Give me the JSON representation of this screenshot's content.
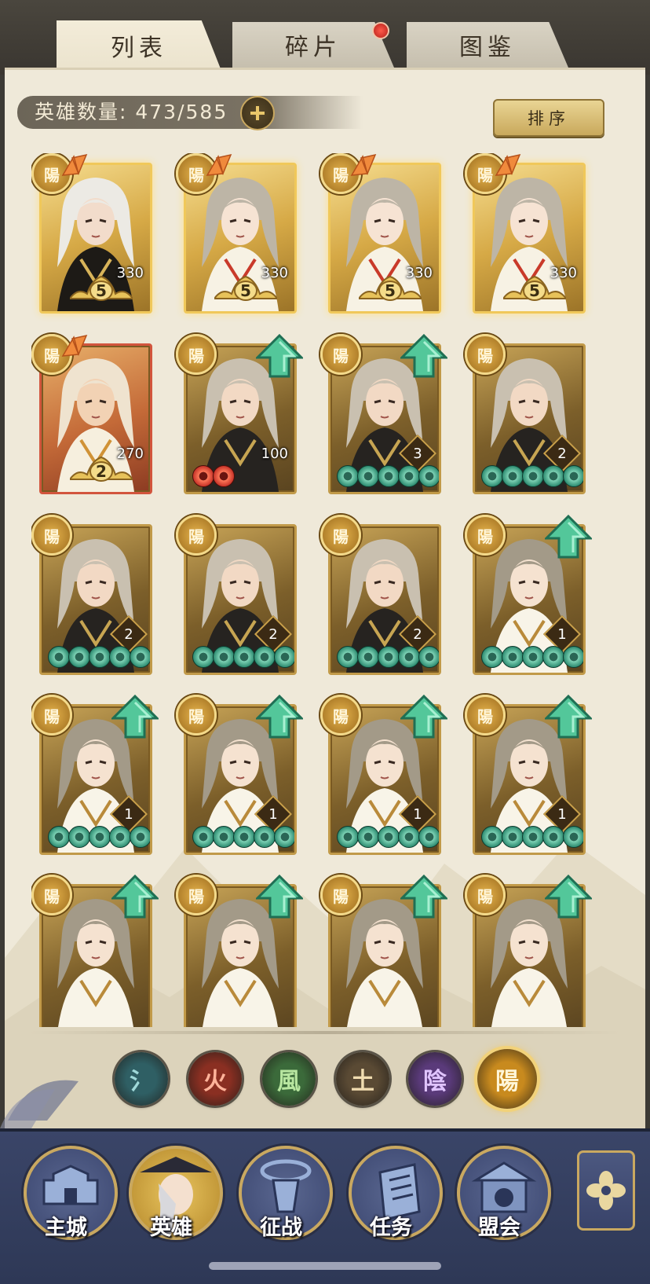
{
  "tabs": [
    {
      "label": "列表",
      "active": true
    },
    {
      "label": "碎片",
      "active": false,
      "has_red_dot": true
    },
    {
      "label": "图鉴",
      "active": false
    }
  ],
  "header": {
    "hero_count_label": "英雄数量: 473/585",
    "plus_icon": "plus-icon",
    "sort_label": "排序"
  },
  "element_glyph": "陽",
  "heroes": [
    {
      "type": "gold",
      "portrait": "white-hair-elder",
      "level": "330",
      "star": "5"
    },
    {
      "type": "gold",
      "portrait": "long-hair-noble",
      "level": "330",
      "star": "5"
    },
    {
      "type": "gold",
      "portrait": "long-hair-noble",
      "level": "330",
      "star": "5"
    },
    {
      "type": "gold",
      "portrait": "long-hair-noble",
      "level": "330",
      "star": "5"
    },
    {
      "type": "red",
      "portrait": "bald-monk",
      "level": "270",
      "star": "2"
    },
    {
      "type": "brown",
      "portrait": "armored-warrior",
      "level": "100",
      "coins": "red2",
      "upgrade": true
    },
    {
      "type": "brown",
      "portrait": "armored-warrior",
      "diamond": "3",
      "coins": "green5",
      "upgrade": true
    },
    {
      "type": "brown",
      "portrait": "armored-warrior",
      "diamond": "2",
      "coins": "green5"
    },
    {
      "type": "brown",
      "portrait": "armored-warrior",
      "diamond": "2",
      "coins": "green5"
    },
    {
      "type": "brown",
      "portrait": "armored-warrior",
      "diamond": "2",
      "coins": "green5"
    },
    {
      "type": "brown",
      "portrait": "armored-warrior",
      "diamond": "2",
      "coins": "green5"
    },
    {
      "type": "brown",
      "portrait": "young-scholar",
      "diamond": "1",
      "coins": "green5",
      "upgrade": true
    },
    {
      "type": "brown",
      "portrait": "young-scholar",
      "diamond": "1",
      "coins": "green5",
      "upgrade": true
    },
    {
      "type": "brown",
      "portrait": "young-scholar",
      "diamond": "1",
      "coins": "green5",
      "upgrade": true
    },
    {
      "type": "brown",
      "portrait": "young-scholar",
      "diamond": "1",
      "coins": "green5",
      "upgrade": true
    },
    {
      "type": "brown",
      "portrait": "young-scholar",
      "diamond": "1",
      "coins": "green5",
      "upgrade": true
    },
    {
      "type": "brown",
      "portrait": "young-scholar",
      "upgrade": true
    },
    {
      "type": "brown",
      "portrait": "young-scholar",
      "upgrade": true
    },
    {
      "type": "brown",
      "portrait": "young-scholar",
      "upgrade": true
    },
    {
      "type": "brown",
      "portrait": "young-scholar",
      "upgrade": true
    }
  ],
  "element_filters": [
    {
      "glyph": "氵",
      "name": "water",
      "color": "#2f5f64",
      "text_color": "#9fd8d8",
      "selected": false
    },
    {
      "glyph": "火",
      "name": "fire",
      "color": "#8a2f22",
      "text_color": "#ffb39a",
      "selected": false
    },
    {
      "glyph": "風",
      "name": "wind",
      "color": "#3b6a3a",
      "text_color": "#b8e6a0",
      "selected": false
    },
    {
      "glyph": "土",
      "name": "earth",
      "color": "#5a4a34",
      "text_color": "#f0dcb0",
      "selected": false
    },
    {
      "glyph": "陰",
      "name": "yin",
      "color": "#5a3a7a",
      "text_color": "#e0c4ff",
      "selected": false
    },
    {
      "glyph": "陽",
      "name": "yang",
      "color": "#c88a1e",
      "text_color": "#fff6d8",
      "selected": true
    }
  ],
  "bottom_nav": [
    {
      "label": "主城",
      "icon": "castle-icon"
    },
    {
      "label": "英雄",
      "icon": "hero-avatar-icon",
      "active": true
    },
    {
      "label": "征战",
      "icon": "battle-icon"
    },
    {
      "label": "任务",
      "icon": "quest-scroll-icon"
    },
    {
      "label": "盟会",
      "icon": "alliance-icon"
    }
  ],
  "extra_nav_icon": "menu-flower-icon"
}
